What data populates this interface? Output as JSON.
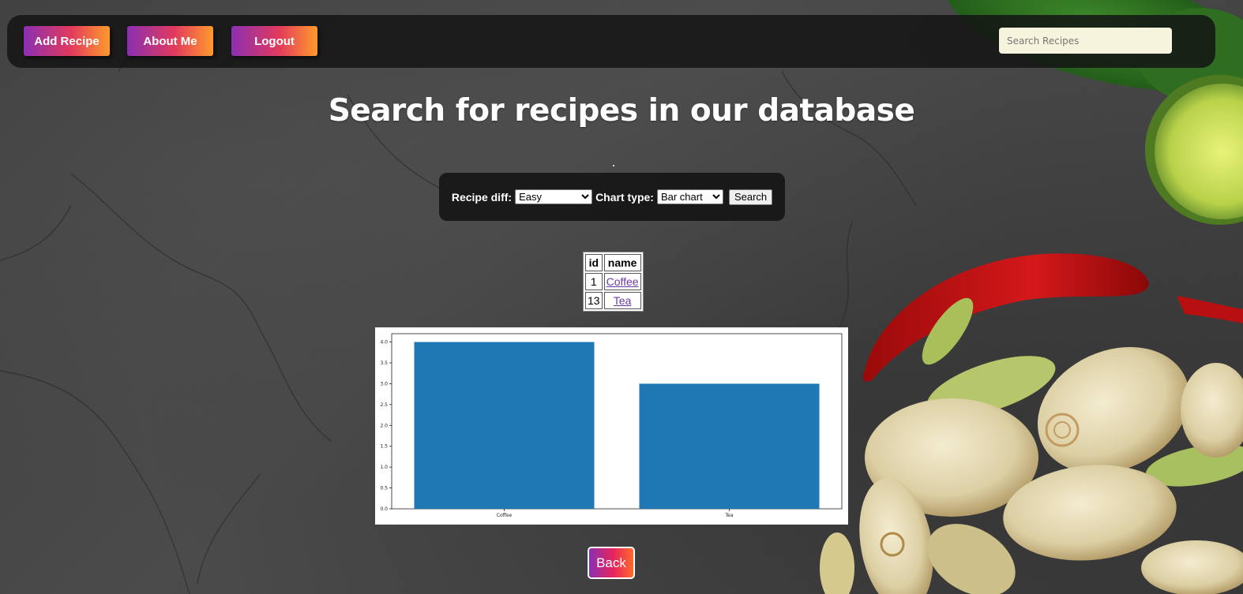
{
  "nav": {
    "add_recipe": "Add Recipe",
    "about_me": "About Me",
    "logout": "Logout",
    "search_placeholder": "Search Recipes"
  },
  "page_title": "Search for recipes in our database",
  "filters": {
    "diff_label": "Recipe diff:",
    "diff_value": "Easy",
    "chart_label": "Chart type:",
    "chart_value": "Bar chart",
    "search_button": "Search"
  },
  "table": {
    "headers": [
      "id",
      "name"
    ],
    "rows": [
      {
        "id": "1",
        "name": "Coffee"
      },
      {
        "id": "13",
        "name": "Tea"
      }
    ]
  },
  "chart_data": {
    "type": "bar",
    "categories": [
      "Coffee",
      "Tea"
    ],
    "values": [
      4,
      3
    ],
    "ylim": [
      0,
      4.2
    ],
    "yticks": [
      "0.0",
      "0.5",
      "1.0",
      "1.5",
      "2.0",
      "2.5",
      "3.0",
      "3.5",
      "4.0"
    ],
    "bar_color": "#1f77b4"
  },
  "back_button": "Back",
  "colors": {
    "accent_gradient_start": "#8a2fb3",
    "accent_gradient_mid": "#e23a5c",
    "accent_gradient_end": "#ff9a2c",
    "link": "#6b3aa0",
    "search_bg": "#f6f4dc"
  }
}
